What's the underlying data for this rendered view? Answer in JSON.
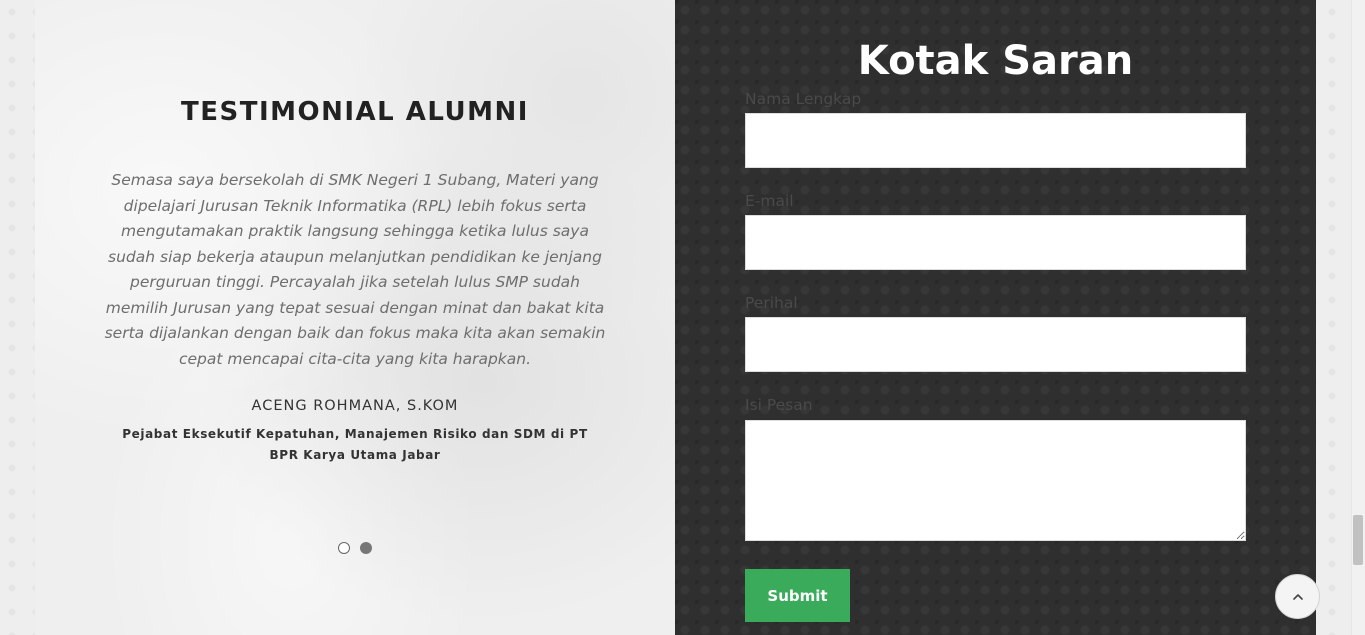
{
  "testimonial": {
    "heading": "TESTIMONIAL ALUMNI",
    "quote": "Semasa saya bersekolah di SMK Negeri 1 Subang, Materi yang dipelajari Jurusan Teknik Informatika (RPL) lebih fokus serta mengutamakan praktik langsung sehingga ketika lulus saya sudah siap bekerja ataupun melanjutkan pendidikan ke jenjang perguruan tinggi. Percayalah jika setelah lulus SMP sudah memilih Jurusan yang tepat sesuai dengan minat dan bakat kita serta dijalankan dengan baik dan fokus maka kita akan semakin cepat mencapai cita-cita yang kita harapkan.",
    "name": "ACENG ROHMANA, S.KOM",
    "role": "Pejabat Eksekutif Kepatuhan, Manajemen Risiko dan SDM di PT BPR Karya Utama Jabar",
    "carousel": {
      "slide_count": 2,
      "active_index": 1
    }
  },
  "form": {
    "title": "Kotak Saran",
    "fields": {
      "name_label": "Nama Lengkap",
      "email_label": "E-mail",
      "subject_label": "Perihal",
      "message_label": "Isi Pesan"
    },
    "values": {
      "name": "",
      "email": "",
      "subject": "",
      "message": ""
    },
    "submit_label": "Submit"
  },
  "scroll_top": {
    "icon": "chevron-up-icon"
  },
  "colors": {
    "submit_green": "#3aaa5b",
    "dark_panel": "#2f2f2f",
    "heading_text": "#222222"
  }
}
